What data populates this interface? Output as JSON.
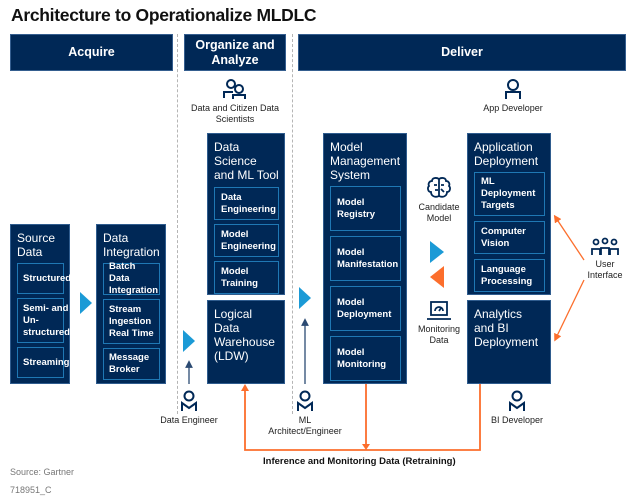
{
  "title": "Architecture to Operationalize MLDLC",
  "phases": {
    "acquire": "Acquire",
    "organize": "Organize and Analyze",
    "deliver": "Deliver"
  },
  "roles": {
    "data_scientists": "Data and Citizen Data Scientists",
    "app_developer": "App Developer",
    "data_engineer": "Data Engineer",
    "ml_architect": "ML Architect/Engineer",
    "bi_developer": "BI Developer",
    "user_interface": "User Interface"
  },
  "boxes": {
    "source_data": {
      "title": "Source Data",
      "items": [
        "Structured",
        "Semi- and Un-structured",
        "Streaming"
      ]
    },
    "data_integration": {
      "title": "Data Integration",
      "items": [
        "Batch Data Integration",
        "Stream Ingestion Real Time",
        "Message Broker"
      ]
    },
    "ds_ml_tool": {
      "title": "Data Science and ML Tool",
      "items": [
        "Data Engineering",
        "Model Engineering",
        "Model Training"
      ]
    },
    "ldw": {
      "title": "Logical Data Warehouse (LDW)"
    },
    "model_mgmt": {
      "title": "Model Management System",
      "items": [
        "Model Registry",
        "Model Manifestation",
        "Model Deployment",
        "Model Monitoring"
      ]
    },
    "app_deploy": {
      "title": "Application Deployment",
      "items": [
        "ML Deployment Targets",
        "Computer Vision",
        "Language Processing"
      ]
    },
    "analytics_bi": {
      "title": "Analytics and BI Deployment"
    }
  },
  "middle": {
    "candidate_model": "Candidate Model",
    "monitoring_data": "Monitoring Data"
  },
  "feedback_label": "Inference and Monitoring Data (Retraining)",
  "source": "Source: Gartner",
  "doc_id": "718951_C",
  "colors": {
    "navy": "#002856",
    "blue_arrow": "#1b9ad6",
    "orange": "#fc6e2c",
    "sub_border": "#1f78b4"
  }
}
